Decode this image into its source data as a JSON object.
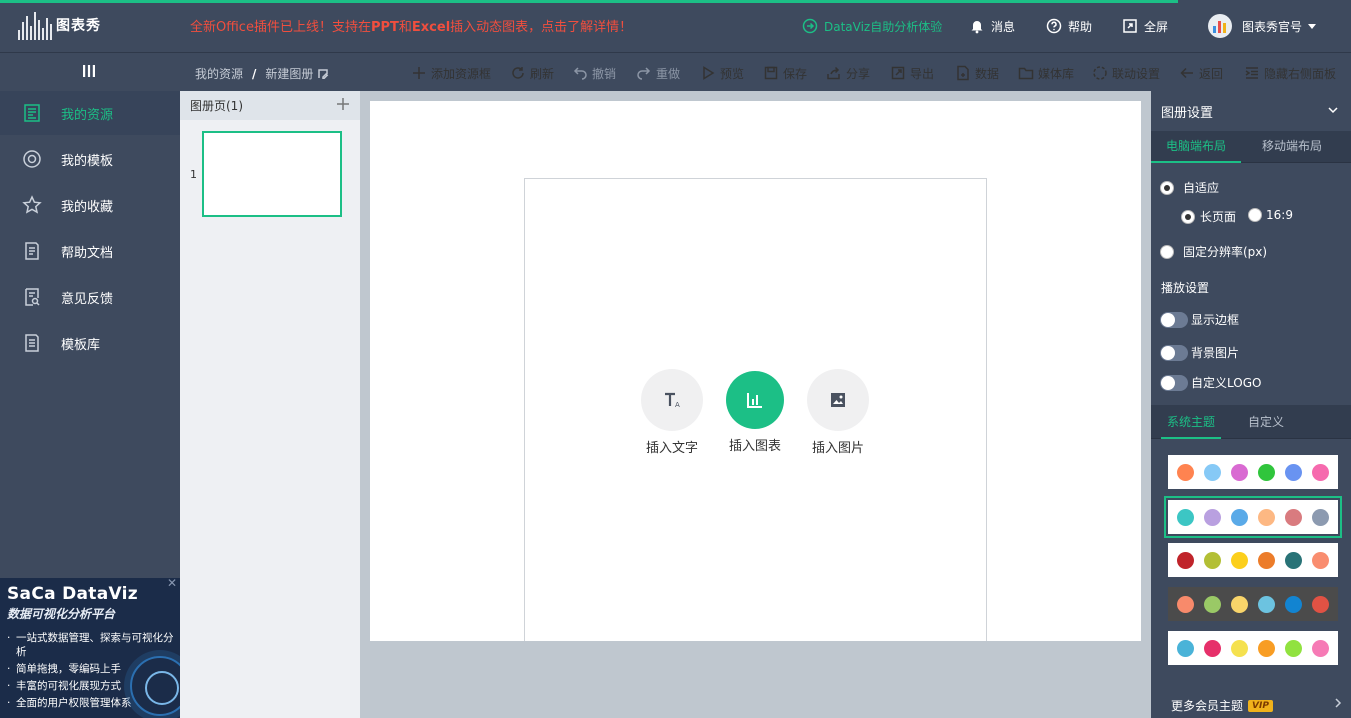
{
  "app": {
    "logo_text": "图表秀"
  },
  "header": {
    "promo_prefix": "全新Office插件已上线！支持在",
    "promo_b1": "PPT",
    "promo_mid": "和",
    "promo_b2": "Excel",
    "promo_suffix": "插入动态图表，点击了解详情！",
    "dataviz_link": "DataViz自助分析体验",
    "messages": "消息",
    "help": "帮助",
    "fullscreen": "全屏",
    "user": "图表秀官号"
  },
  "breadcrumb": {
    "root": "我的资源",
    "separator": "/",
    "current": "新建图册"
  },
  "toolbar": {
    "add_frame": "添加资源框",
    "refresh": "刷新",
    "undo": "撤销",
    "redo": "重做",
    "preview": "预览",
    "save": "保存",
    "share": "分享",
    "export": "导出",
    "data": "数据",
    "media": "媒体库",
    "linkage": "联动设置",
    "back": "返回",
    "hide_panel": "隐藏右侧面板"
  },
  "sidebar": {
    "items": [
      {
        "label": "我的资源",
        "icon": "resource-icon",
        "active": true
      },
      {
        "label": "我的模板",
        "icon": "template-icon"
      },
      {
        "label": "我的收藏",
        "icon": "star-icon"
      },
      {
        "label": "帮助文档",
        "icon": "document-icon"
      },
      {
        "label": "意见反馈",
        "icon": "feedback-icon"
      },
      {
        "label": "模板库",
        "icon": "library-icon"
      }
    ]
  },
  "ad": {
    "title": "SaCa DataViz",
    "subtitle": "数据可视化分析平台",
    "bullets": [
      "一站式数据管理、探索与可视化分析",
      "简单拖拽，零编码上手",
      "丰富的可视化展现方式",
      "全面的用户权限管理体系"
    ],
    "close": "✕"
  },
  "pages": {
    "header": "图册页(1)",
    "items": [
      {
        "number": "1"
      }
    ]
  },
  "canvas": {
    "insert_text": "插入文字",
    "insert_chart": "插入图表",
    "insert_image": "插入图片"
  },
  "right_panel": {
    "title": "图册设置",
    "layout_tabs": [
      "电脑端布局",
      "移动端布局"
    ],
    "adaptive": "自适应",
    "long_page": "长页面",
    "ratio": "16:9",
    "fixed_resolution": "固定分辨率(px)",
    "playback_title": "播放设置",
    "toggles": [
      "显示边框",
      "背景图片",
      "自定义LOGO"
    ],
    "theme_tabs": [
      "系统主题",
      "自定义"
    ],
    "themes": [
      [
        "#ff8350",
        "#86c9f6",
        "#d96ad2",
        "#30c53c",
        "#6993f1",
        "#f66aae"
      ],
      [
        "#3cc6c4",
        "#b9a0e0",
        "#5aaae8",
        "#fdb883",
        "#d97b7f",
        "#8c9ab0"
      ],
      [
        "#c0242a",
        "#b3bf35",
        "#fccf1c",
        "#ec7c2a",
        "#297377",
        "#f98d6f"
      ],
      [
        "#f88a6b",
        "#9ac966",
        "#f9d56a",
        "#6cc3e0",
        "#1284d1",
        "#e15244"
      ],
      [
        "#4ab3d8",
        "#e6306a",
        "#f5e14f",
        "#f89d24",
        "#91e240",
        "#f67ab5"
      ]
    ],
    "more_themes": "更多会员主题",
    "vip": "VIP"
  }
}
